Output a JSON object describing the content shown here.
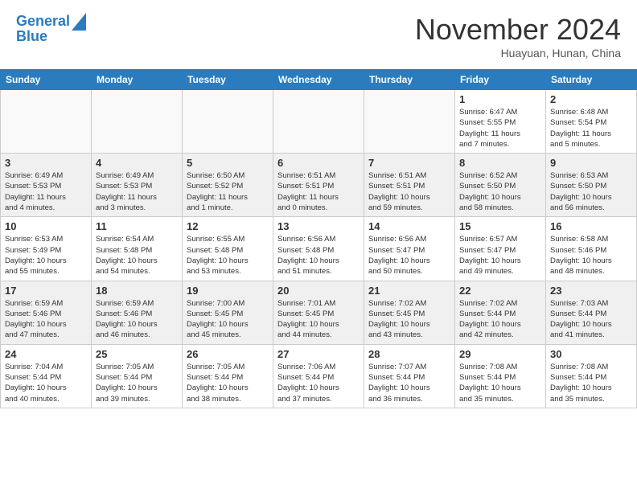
{
  "header": {
    "logo_line1": "General",
    "logo_line2": "Blue",
    "month": "November 2024",
    "location": "Huayuan, Hunan, China"
  },
  "weekdays": [
    "Sunday",
    "Monday",
    "Tuesday",
    "Wednesday",
    "Thursday",
    "Friday",
    "Saturday"
  ],
  "weeks": [
    [
      {
        "day": "",
        "info": ""
      },
      {
        "day": "",
        "info": ""
      },
      {
        "day": "",
        "info": ""
      },
      {
        "day": "",
        "info": ""
      },
      {
        "day": "",
        "info": ""
      },
      {
        "day": "1",
        "info": "Sunrise: 6:47 AM\nSunset: 5:55 PM\nDaylight: 11 hours\nand 7 minutes."
      },
      {
        "day": "2",
        "info": "Sunrise: 6:48 AM\nSunset: 5:54 PM\nDaylight: 11 hours\nand 5 minutes."
      }
    ],
    [
      {
        "day": "3",
        "info": "Sunrise: 6:49 AM\nSunset: 5:53 PM\nDaylight: 11 hours\nand 4 minutes."
      },
      {
        "day": "4",
        "info": "Sunrise: 6:49 AM\nSunset: 5:53 PM\nDaylight: 11 hours\nand 3 minutes."
      },
      {
        "day": "5",
        "info": "Sunrise: 6:50 AM\nSunset: 5:52 PM\nDaylight: 11 hours\nand 1 minute."
      },
      {
        "day": "6",
        "info": "Sunrise: 6:51 AM\nSunset: 5:51 PM\nDaylight: 11 hours\nand 0 minutes."
      },
      {
        "day": "7",
        "info": "Sunrise: 6:51 AM\nSunset: 5:51 PM\nDaylight: 10 hours\nand 59 minutes."
      },
      {
        "day": "8",
        "info": "Sunrise: 6:52 AM\nSunset: 5:50 PM\nDaylight: 10 hours\nand 58 minutes."
      },
      {
        "day": "9",
        "info": "Sunrise: 6:53 AM\nSunset: 5:50 PM\nDaylight: 10 hours\nand 56 minutes."
      }
    ],
    [
      {
        "day": "10",
        "info": "Sunrise: 6:53 AM\nSunset: 5:49 PM\nDaylight: 10 hours\nand 55 minutes."
      },
      {
        "day": "11",
        "info": "Sunrise: 6:54 AM\nSunset: 5:48 PM\nDaylight: 10 hours\nand 54 minutes."
      },
      {
        "day": "12",
        "info": "Sunrise: 6:55 AM\nSunset: 5:48 PM\nDaylight: 10 hours\nand 53 minutes."
      },
      {
        "day": "13",
        "info": "Sunrise: 6:56 AM\nSunset: 5:48 PM\nDaylight: 10 hours\nand 51 minutes."
      },
      {
        "day": "14",
        "info": "Sunrise: 6:56 AM\nSunset: 5:47 PM\nDaylight: 10 hours\nand 50 minutes."
      },
      {
        "day": "15",
        "info": "Sunrise: 6:57 AM\nSunset: 5:47 PM\nDaylight: 10 hours\nand 49 minutes."
      },
      {
        "day": "16",
        "info": "Sunrise: 6:58 AM\nSunset: 5:46 PM\nDaylight: 10 hours\nand 48 minutes."
      }
    ],
    [
      {
        "day": "17",
        "info": "Sunrise: 6:59 AM\nSunset: 5:46 PM\nDaylight: 10 hours\nand 47 minutes."
      },
      {
        "day": "18",
        "info": "Sunrise: 6:59 AM\nSunset: 5:46 PM\nDaylight: 10 hours\nand 46 minutes."
      },
      {
        "day": "19",
        "info": "Sunrise: 7:00 AM\nSunset: 5:45 PM\nDaylight: 10 hours\nand 45 minutes."
      },
      {
        "day": "20",
        "info": "Sunrise: 7:01 AM\nSunset: 5:45 PM\nDaylight: 10 hours\nand 44 minutes."
      },
      {
        "day": "21",
        "info": "Sunrise: 7:02 AM\nSunset: 5:45 PM\nDaylight: 10 hours\nand 43 minutes."
      },
      {
        "day": "22",
        "info": "Sunrise: 7:02 AM\nSunset: 5:44 PM\nDaylight: 10 hours\nand 42 minutes."
      },
      {
        "day": "23",
        "info": "Sunrise: 7:03 AM\nSunset: 5:44 PM\nDaylight: 10 hours\nand 41 minutes."
      }
    ],
    [
      {
        "day": "24",
        "info": "Sunrise: 7:04 AM\nSunset: 5:44 PM\nDaylight: 10 hours\nand 40 minutes."
      },
      {
        "day": "25",
        "info": "Sunrise: 7:05 AM\nSunset: 5:44 PM\nDaylight: 10 hours\nand 39 minutes."
      },
      {
        "day": "26",
        "info": "Sunrise: 7:05 AM\nSunset: 5:44 PM\nDaylight: 10 hours\nand 38 minutes."
      },
      {
        "day": "27",
        "info": "Sunrise: 7:06 AM\nSunset: 5:44 PM\nDaylight: 10 hours\nand 37 minutes."
      },
      {
        "day": "28",
        "info": "Sunrise: 7:07 AM\nSunset: 5:44 PM\nDaylight: 10 hours\nand 36 minutes."
      },
      {
        "day": "29",
        "info": "Sunrise: 7:08 AM\nSunset: 5:44 PM\nDaylight: 10 hours\nand 35 minutes."
      },
      {
        "day": "30",
        "info": "Sunrise: 7:08 AM\nSunset: 5:44 PM\nDaylight: 10 hours\nand 35 minutes."
      }
    ]
  ]
}
